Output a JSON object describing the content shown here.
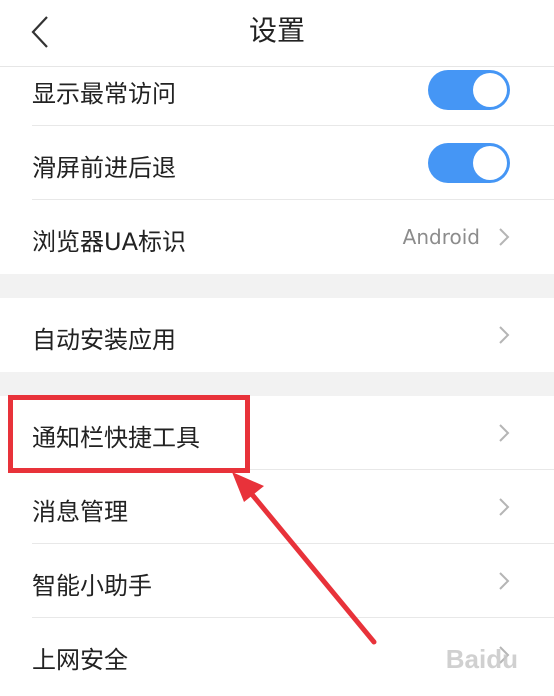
{
  "header": {
    "title": "设置",
    "back_icon": "chevron-left-icon"
  },
  "settings": {
    "show_frequent": {
      "label": "显示最常访问",
      "enabled": true
    },
    "swipe_nav": {
      "label": "滑屏前进后退",
      "enabled": true
    },
    "ua": {
      "label": "浏览器UA标识",
      "value": "Android"
    },
    "auto_install": {
      "label": "自动安装应用"
    },
    "notification_tools": {
      "label": "通知栏快捷工具"
    },
    "message_mgmt": {
      "label": "消息管理"
    },
    "smart_assistant": {
      "label": "智能小助手"
    },
    "web_security": {
      "label": "上网安全"
    }
  },
  "colors": {
    "toggle_on": "#4596f5",
    "highlight": "#e8323a"
  },
  "watermark": "Baidu"
}
